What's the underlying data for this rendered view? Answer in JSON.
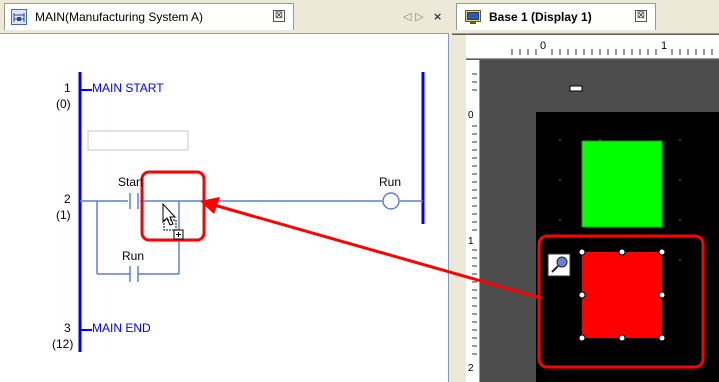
{
  "left_tab": {
    "label": "MAIN(Manufacturing System A)",
    "close": "⊠"
  },
  "left_controls": {
    "nav": "◁ ▷",
    "close": "×"
  },
  "ladder": {
    "rungs": [
      {
        "number": "1",
        "step": "(0)",
        "instruction": "MAIN START"
      },
      {
        "number": "2",
        "step": "(1)",
        "contacts": [
          "Start",
          "Run"
        ],
        "coil": "Run"
      },
      {
        "number": "3",
        "step": "(12)",
        "instruction": "MAIN END"
      }
    ]
  },
  "right_tab": {
    "label": "Base 1 (Display 1)",
    "close": "⊠"
  },
  "rulers": {
    "horizontal_marks": [
      "0",
      "1"
    ],
    "vertical_marks": [
      "0",
      "1",
      "2"
    ]
  },
  "colors": {
    "rail": "#0000ff",
    "wire": "#5f7fcf",
    "callout": "#ff0000",
    "lamp_on": "#00ff00",
    "lamp_off": "#ff0000",
    "screen_bg": "#000000"
  },
  "icons": {
    "ladder_tab": "ladder-program-icon",
    "screen_tab": "screen-display-icon",
    "parts_tool": "magnifier-parts-icon",
    "cursor": "drag-copy-cursor-icon"
  }
}
